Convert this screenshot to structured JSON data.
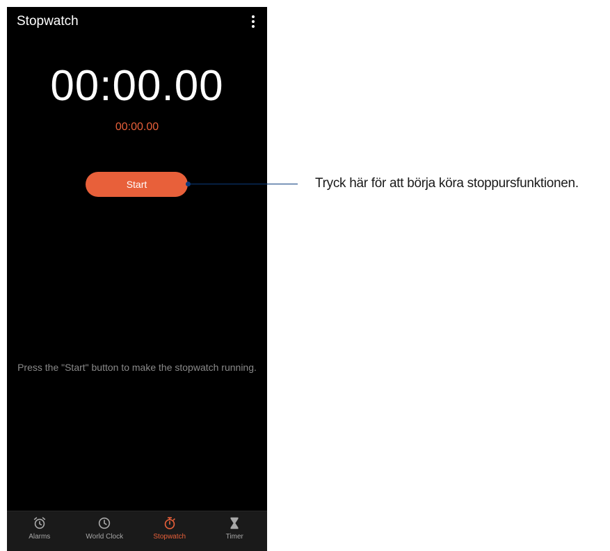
{
  "header": {
    "title": "Stopwatch",
    "menu_icon": "more-vert-icon"
  },
  "stopwatch": {
    "main_time": "00:00.00",
    "lap_time": "00:00.00",
    "start_label": "Start"
  },
  "hint": "Press the \"Start\" button to make the stopwatch running.",
  "nav": {
    "items": [
      {
        "label": "Alarms",
        "icon": "alarm-icon"
      },
      {
        "label": "World Clock",
        "icon": "clock-icon"
      },
      {
        "label": "Stopwatch",
        "icon": "stopwatch-icon",
        "active": true
      },
      {
        "label": "Timer",
        "icon": "hourglass-icon"
      }
    ]
  },
  "callout": {
    "text": "Tryck här för att börja köra stoppursfunktionen."
  },
  "colors": {
    "accent": "#e8603a",
    "background": "#000000",
    "callout_line": "#0a3a7c"
  }
}
